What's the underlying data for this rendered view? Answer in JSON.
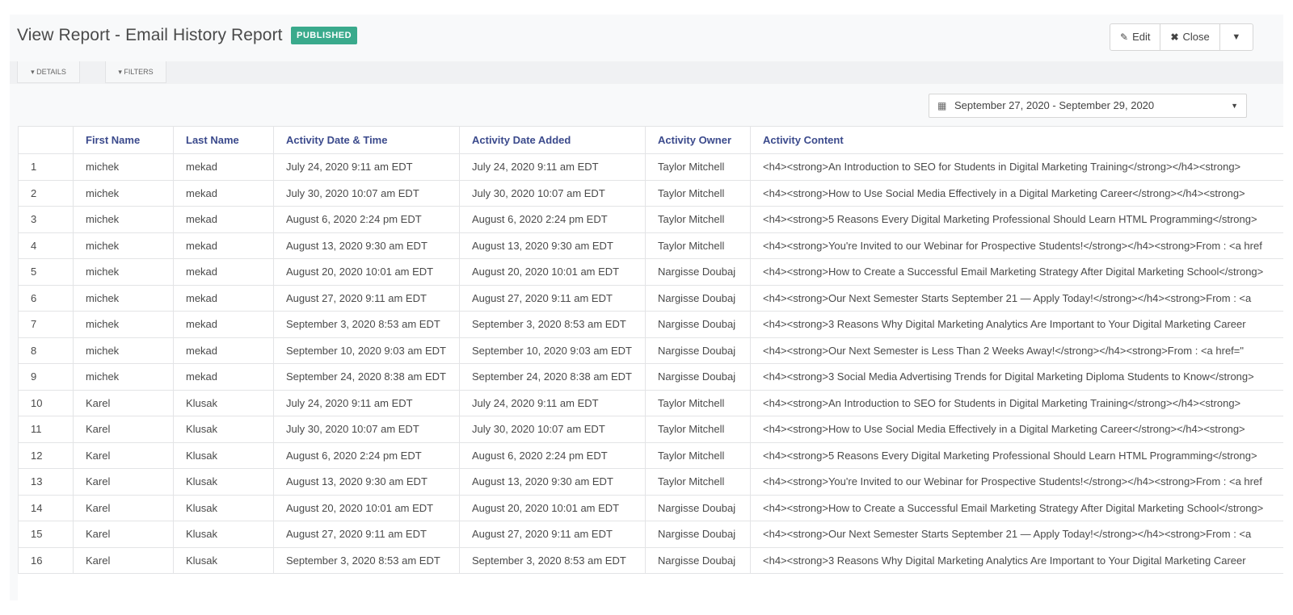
{
  "header": {
    "title": "View Report - Email History Report",
    "badge": "PUBLISHED",
    "edit_label": "Edit",
    "close_label": "Close"
  },
  "tabs": {
    "details": "DETAILS",
    "filters": "FILTERS"
  },
  "date_range": "September 27, 2020 - September 29, 2020",
  "table": {
    "columns": [
      "",
      "First Name",
      "Last Name",
      "Activity Date & Time",
      "Activity Date Added",
      "Activity Owner",
      "Activity Content"
    ],
    "rows": [
      [
        "1",
        "michek",
        "mekad",
        "July 24, 2020 9:11 am EDT",
        "July 24, 2020 9:11 am EDT",
        "Taylor Mitchell",
        "<h4><strong>An Introduction to SEO for Students in Digital Marketing Training</strong></h4><strong>"
      ],
      [
        "2",
        "michek",
        "mekad",
        "July 30, 2020 10:07 am EDT",
        "July 30, 2020 10:07 am EDT",
        "Taylor Mitchell",
        "<h4><strong>How to Use Social Media Effectively in a Digital Marketing Career</strong></h4><strong>"
      ],
      [
        "3",
        "michek",
        "mekad",
        "August 6, 2020 2:24 pm EDT",
        "August 6, 2020 2:24 pm EDT",
        "Taylor Mitchell",
        "<h4><strong>5 Reasons Every Digital Marketing Professional Should Learn HTML Programming</strong>"
      ],
      [
        "4",
        "michek",
        "mekad",
        "August 13, 2020 9:30 am EDT",
        "August 13, 2020 9:30 am EDT",
        "Taylor Mitchell",
        "<h4><strong>You're Invited to our Webinar for Prospective Students!</strong></h4><strong>From : <a href"
      ],
      [
        "5",
        "michek",
        "mekad",
        "August 20, 2020 10:01 am EDT",
        "August 20, 2020 10:01 am EDT",
        "Nargisse Doubaj",
        "<h4><strong>How to Create a Successful Email Marketing Strategy After Digital Marketing School</strong>"
      ],
      [
        "6",
        "michek",
        "mekad",
        "August 27, 2020 9:11 am EDT",
        "August 27, 2020 9:11 am EDT",
        "Nargisse Doubaj",
        "<h4><strong>Our Next Semester Starts September 21 — Apply Today!</strong></h4><strong>From : <a"
      ],
      [
        "7",
        "michek",
        "mekad",
        "September 3, 2020 8:53 am EDT",
        "September 3, 2020 8:53 am EDT",
        "Nargisse Doubaj",
        "<h4><strong>3 Reasons Why Digital Marketing Analytics Are Important to Your Digital Marketing Career"
      ],
      [
        "8",
        "michek",
        "mekad",
        "September 10, 2020 9:03 am EDT",
        "September 10, 2020 9:03 am EDT",
        "Nargisse Doubaj",
        "<h4><strong>Our Next Semester is Less Than 2 Weeks Away!</strong></h4><strong>From : <a href=\""
      ],
      [
        "9",
        "michek",
        "mekad",
        "September 24, 2020 8:38 am EDT",
        "September 24, 2020 8:38 am EDT",
        "Nargisse Doubaj",
        "<h4><strong>3 Social Media Advertising Trends for Digital Marketing Diploma Students to Know</strong>"
      ],
      [
        "10",
        "Karel",
        "Klusak",
        "July 24, 2020 9:11 am EDT",
        "July 24, 2020 9:11 am EDT",
        "Taylor Mitchell",
        "<h4><strong>An Introduction to SEO for Students in Digital Marketing Training</strong></h4><strong>"
      ],
      [
        "11",
        "Karel",
        "Klusak",
        "July 30, 2020 10:07 am EDT",
        "July 30, 2020 10:07 am EDT",
        "Taylor Mitchell",
        "<h4><strong>How to Use Social Media Effectively in a Digital Marketing Career</strong></h4><strong>"
      ],
      [
        "12",
        "Karel",
        "Klusak",
        "August 6, 2020 2:24 pm EDT",
        "August 6, 2020 2:24 pm EDT",
        "Taylor Mitchell",
        "<h4><strong>5 Reasons Every Digital Marketing Professional Should Learn HTML Programming</strong>"
      ],
      [
        "13",
        "Karel",
        "Klusak",
        "August 13, 2020 9:30 am EDT",
        "August 13, 2020 9:30 am EDT",
        "Taylor Mitchell",
        "<h4><strong>You're Invited to our Webinar for Prospective Students!</strong></h4><strong>From : <a href"
      ],
      [
        "14",
        "Karel",
        "Klusak",
        "August 20, 2020 10:01 am EDT",
        "August 20, 2020 10:01 am EDT",
        "Nargisse Doubaj",
        "<h4><strong>How to Create a Successful Email Marketing Strategy After Digital Marketing School</strong>"
      ],
      [
        "15",
        "Karel",
        "Klusak",
        "August 27, 2020 9:11 am EDT",
        "August 27, 2020 9:11 am EDT",
        "Nargisse Doubaj",
        "<h4><strong>Our Next Semester Starts September 21 — Apply Today!</strong></h4><strong>From : <a"
      ],
      [
        "16",
        "Karel",
        "Klusak",
        "September 3, 2020 8:53 am EDT",
        "September 3, 2020 8:53 am EDT",
        "Nargisse Doubaj",
        "<h4><strong>3 Reasons Why Digital Marketing Analytics Are Important to Your Digital Marketing Career"
      ]
    ]
  },
  "colors": {
    "badge": "#3aaa8c",
    "header_text": "#3b4a8c"
  },
  "icons": {
    "edit": "edit-icon",
    "close": "close-icon",
    "calendar": "calendar-icon",
    "caret": "caret-down-icon"
  }
}
